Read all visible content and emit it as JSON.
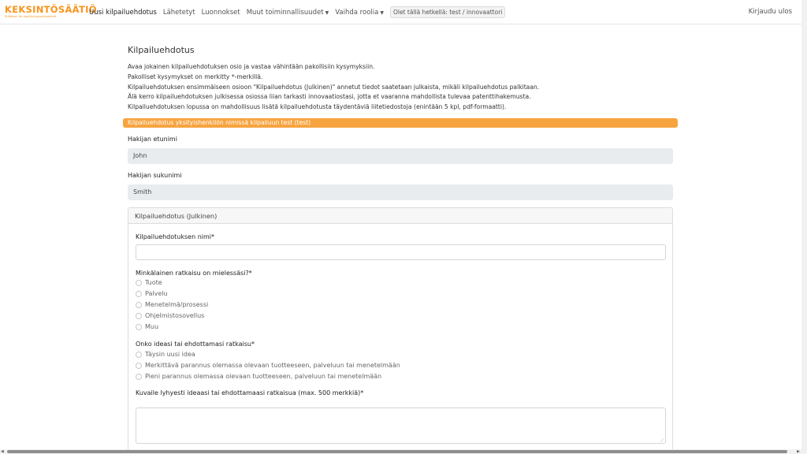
{
  "brand": {
    "name": "KEKSINTÖSÄÄTIÖ",
    "tagline": "Stiftelsen för Uppfinningsverksamhet",
    "color": "#f7941d"
  },
  "nav": {
    "items": [
      {
        "label": "Uusi kilpailuehdotus"
      },
      {
        "label": "Lähetetyt"
      },
      {
        "label": "Luonnokset"
      },
      {
        "label": "Muut toiminnallisuudet"
      },
      {
        "label": "Vaihda roolia"
      }
    ],
    "role_badge": "Olet tällä hetkellä: test / innovaattori",
    "logout": "Kirjaudu ulos"
  },
  "page": {
    "title": "Kilpailuehdotus",
    "intro": [
      "Avaa jokainen kilpailuehdotuksen osio ja vastaa vähintään pakollisiin kysymyksiin.",
      "Pakolliset kysymykset on merkitty *-merkillä.",
      "Kilpailuehdotuksen ensimmäiseen osioon \"Kilpailuehdotus (Julkinen)\" annetut tiedot saatetaan julkaista, mikäli kilpailuehdotus palkitaan.",
      "Älä kerro kilpailuehdotuksen julkisessa osiossa liian tarkasti innovaatiostasi, jotta et vaaranna mahdollista tulevaa patenttihakemusta.",
      "Kilpailuehdotuksen lopussa on mahdollisuus lisätä kilpailuehdotusta täydentäviä liitetiedostoja (enintään 5 kpl, pdf-formaatti)."
    ],
    "alert": "Kilpailuehdotus yksityishenkilön nimissä kilpailuun test (test)",
    "alert_color": "#f7a440"
  },
  "applicant": {
    "first_name_label": "Hakijan etunimi",
    "first_name_value": "John",
    "last_name_label": "Hakijan sukunimi",
    "last_name_value": "Smith"
  },
  "section": {
    "header": "Kilpailuehdotus (Julkinen)",
    "name_label": "Kilpailuehdotuksen nimi*",
    "name_value": "",
    "solution_type": {
      "label": "Minkälainen ratkaisu on mielessäsi?*",
      "options": [
        "Tuote",
        "Palvelu",
        "Menetelmä/prosessi",
        "Ohjelmistosovellus",
        "Muu"
      ]
    },
    "novelty": {
      "label": "Onko ideasi tai ehdottamasi ratkaisu*",
      "options": [
        "Täysin uusi idea",
        "Merkittävä parannus olemassa olevaan tuotteeseen, palveluun tai menetelmään",
        "Pieni parannus olemassa olevaan tuotteeseen, palveluun tai menetelmään"
      ]
    },
    "description_label": "Kuvaile lyhyesti ideaasi tai ehdottamaasi ratkaisua (max. 500 merkkiä)*",
    "description_value": ""
  }
}
